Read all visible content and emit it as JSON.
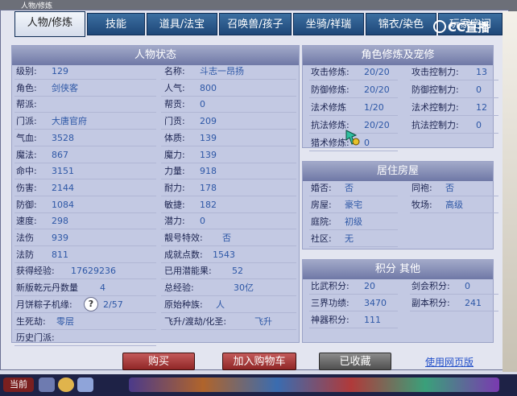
{
  "window": {
    "title": "人物/修炼"
  },
  "tabs": [
    "人物/修炼",
    "技能",
    "道具/法宝",
    "召唤兽/孩子",
    "坐骑/祥瑞",
    "锦衣/染色",
    "玩家空间"
  ],
  "brand": {
    "name": "CC直播"
  },
  "status": {
    "title": "人物状态",
    "left": [
      {
        "label": "级别:",
        "value": "129"
      },
      {
        "label": "角色:",
        "value": "剑侠客"
      },
      {
        "label": "帮派:",
        "value": ""
      },
      {
        "label": "门派:",
        "value": "大唐官府"
      },
      {
        "label": "气血:",
        "value": "3528"
      },
      {
        "label": "魔法:",
        "value": "867"
      },
      {
        "label": "命中:",
        "value": "3151"
      },
      {
        "label": "伤害:",
        "value": "2144"
      },
      {
        "label": "防御:",
        "value": "1084"
      },
      {
        "label": "速度:",
        "value": "298"
      },
      {
        "label": "法伤",
        "value": "939"
      },
      {
        "label": "法防",
        "value": "811"
      },
      {
        "label": "获得经验:",
        "value": "17629236"
      },
      {
        "label": "新版乾元丹数量",
        "value": "4"
      },
      {
        "label": "月饼粽子机缘:",
        "value": "2/57"
      },
      {
        "label": "生死劫:",
        "value": "零层"
      },
      {
        "label": "历史门派:",
        "value": ""
      }
    ],
    "right": [
      {
        "label": "名称:",
        "value": "斗志一昂扬"
      },
      {
        "label": "人气:",
        "value": "800"
      },
      {
        "label": "帮贡:",
        "value": "0"
      },
      {
        "label": "门贡:",
        "value": "209"
      },
      {
        "label": "体质:",
        "value": "139"
      },
      {
        "label": "魔力:",
        "value": "139"
      },
      {
        "label": "力量:",
        "value": "918"
      },
      {
        "label": "耐力:",
        "value": "178"
      },
      {
        "label": "敏捷:",
        "value": "182"
      },
      {
        "label": "潜力:",
        "value": "0"
      },
      {
        "label": "靓号特效:",
        "value": "否"
      },
      {
        "label": "成就点数:",
        "value": "1543"
      },
      {
        "label": "已用潜能果:",
        "value": "52"
      },
      {
        "label": "总经验:",
        "value": "30亿"
      },
      {
        "label": "原始种族:",
        "value": "人"
      },
      {
        "label": "飞升/渡劫/化圣:",
        "value": "飞升"
      }
    ]
  },
  "cultivation": {
    "title": "角色修炼及宠修",
    "left": [
      {
        "label": "攻击修炼:",
        "value": "20/20"
      },
      {
        "label": "防御修炼:",
        "value": "20/20"
      },
      {
        "label": "法术修炼",
        "value": "1/20"
      },
      {
        "label": "抗法修炼:",
        "value": "20/20"
      },
      {
        "label": "猎术修炼:",
        "value": "0"
      }
    ],
    "right": [
      {
        "label": "攻击控制力:",
        "value": "13"
      },
      {
        "label": "防御控制力:",
        "value": "0"
      },
      {
        "label": "法术控制力:",
        "value": "12"
      },
      {
        "label": "抗法控制力:",
        "value": "0"
      }
    ]
  },
  "housing": {
    "title": "居住房屋",
    "left": [
      {
        "label": "婚否:",
        "value": "否"
      },
      {
        "label": "房屋:",
        "value": "豪宅"
      },
      {
        "label": "庭院:",
        "value": "初级"
      },
      {
        "label": "社区:",
        "value": "无"
      }
    ],
    "right": [
      {
        "label": "同袍:",
        "value": "否"
      },
      {
        "label": "牧场:",
        "value": "高级"
      }
    ]
  },
  "points": {
    "title": "积分 其他",
    "left": [
      {
        "label": "比武积分:",
        "value": "20"
      },
      {
        "label": "三界功绩:",
        "value": "3470"
      },
      {
        "label": "神器积分:",
        "value": "111"
      }
    ],
    "right": [
      {
        "label": "剑会积分:",
        "value": "0"
      },
      {
        "label": "副本积分:",
        "value": "241"
      }
    ]
  },
  "actions": {
    "buy": "购买",
    "add_cart": "加入购物车",
    "favorited": "已收藏",
    "web_link": "使用网页版"
  },
  "taskbar": {
    "label": "当前"
  }
}
